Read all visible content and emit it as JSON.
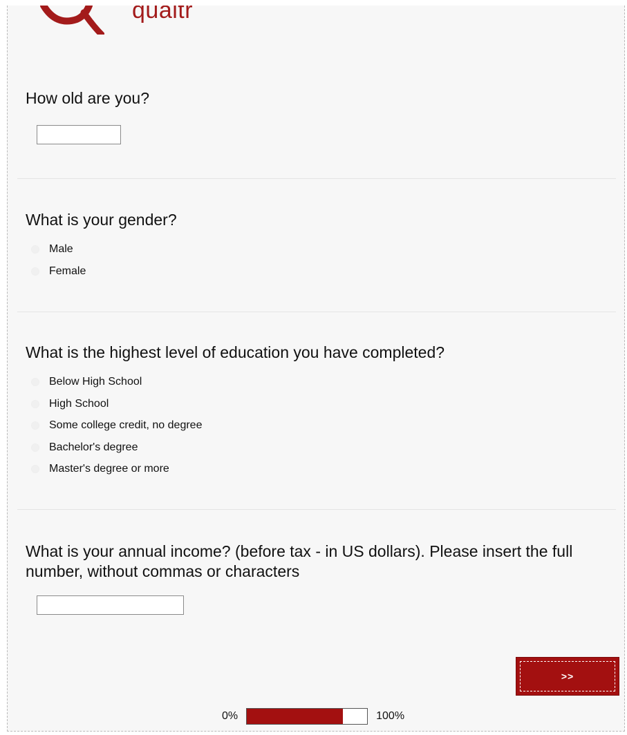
{
  "logo": {
    "text": "qualtrics",
    "color": "#a31b1b"
  },
  "questions": [
    {
      "id": "age",
      "text": "How old are you?",
      "type": "text",
      "value": ""
    },
    {
      "id": "gender",
      "text": "What is your gender?",
      "type": "radio",
      "choices": [
        "Male",
        "Female"
      ]
    },
    {
      "id": "education",
      "text": "What is the highest level of education you have completed?",
      "type": "radio",
      "choices": [
        "Below High School",
        "High School",
        "Some college credit, no degree",
        "Bachelor's degree",
        "Master's degree or more"
      ]
    },
    {
      "id": "income",
      "text": "What is your annual income? (before tax - in US dollars). Please insert the full number, without commas or characters",
      "type": "text",
      "value": ""
    }
  ],
  "navigation": {
    "next_label": ">>"
  },
  "progress": {
    "start_label": "0%",
    "end_label": "100%",
    "fraction": 0.8,
    "fill_color": "#a31010"
  }
}
